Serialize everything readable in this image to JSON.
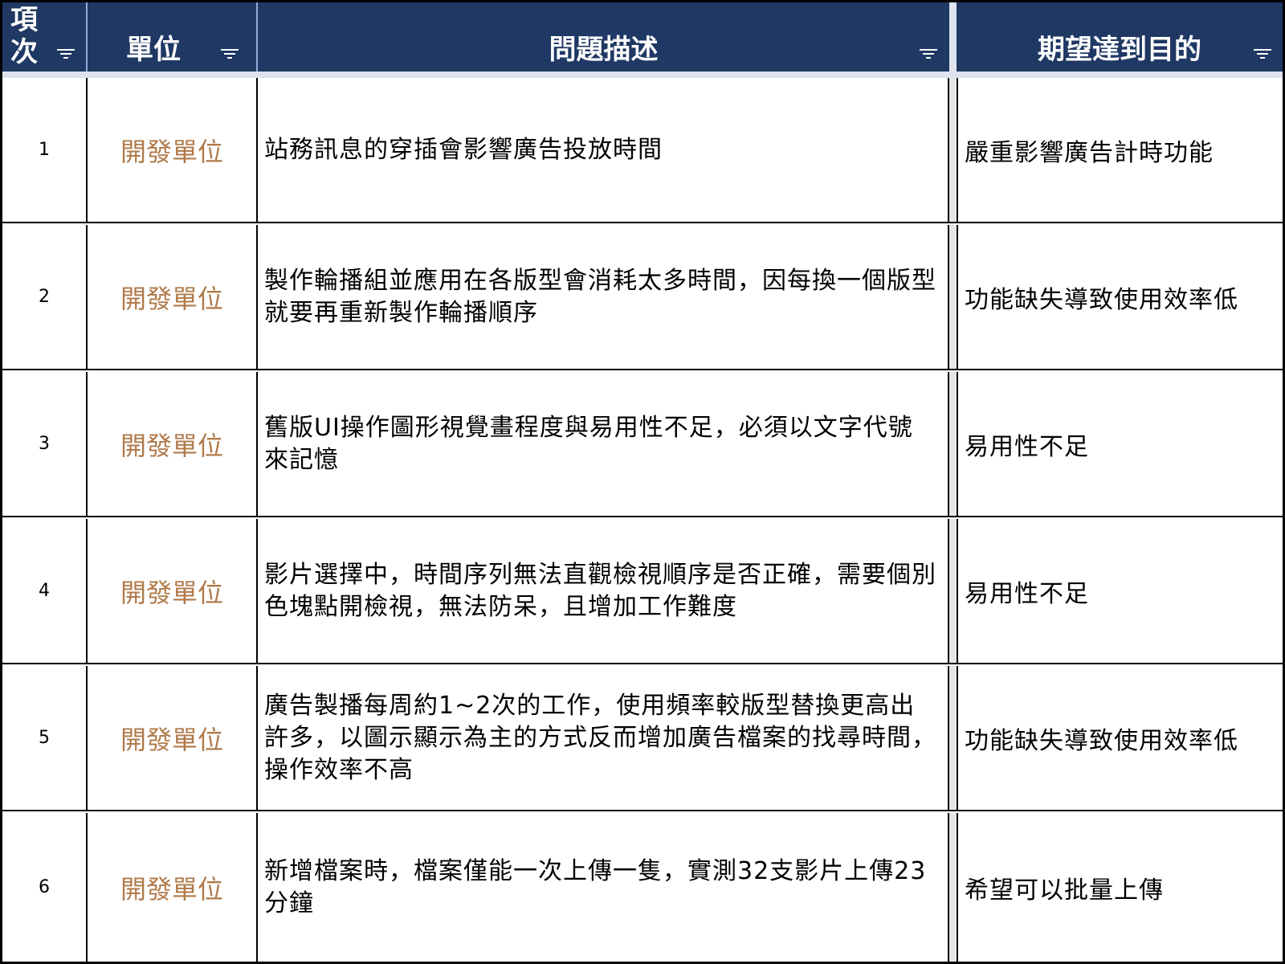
{
  "table": {
    "headers": {
      "index": [
        "項",
        "次"
      ],
      "unit": "單位",
      "problem": "問題描述",
      "goal": "期望達到目的"
    },
    "rows": [
      {
        "index": "1",
        "unit": "開發單位",
        "problem": "站務訊息的穿插會影響廣告投放時間",
        "goal": "嚴重影響廣告計時功能"
      },
      {
        "index": "2",
        "unit": "開發單位",
        "problem": "製作輪播組並應用在各版型會消耗太多時間，因每換一個版型就要再重新製作輪播順序",
        "goal": "功能缺失導致使用效率低"
      },
      {
        "index": "3",
        "unit": "開發單位",
        "problem": "舊版UI操作圖形視覺畫程度與易用性不足，必須以文字代號來記憶",
        "goal": "易用性不足"
      },
      {
        "index": "4",
        "unit": "開發單位",
        "problem": "影片選擇中，時間序列無法直觀檢視順序是否正確，需要個別色塊點開檢視，無法防呆，且增加工作難度",
        "goal": "易用性不足"
      },
      {
        "index": "5",
        "unit": "開發單位",
        "problem": "廣告製播每周約1~2次的工作，使用頻率較版型替換更高出許多，以圖示顯示為主的方式反而增加廣告檔案的找尋時間，操作效率不高",
        "goal": "功能缺失導致使用效率低"
      },
      {
        "index": "6",
        "unit": "開發單位",
        "problem": "新增檔案時，檔案僅能一次上傳一隻，實測32支影片上傳23分鐘",
        "goal": "希望可以批量上傳"
      }
    ]
  },
  "colors": {
    "header_bg": "#1f3864",
    "header_text": "#ffffff",
    "unit_text": "#b07a4a",
    "border": "#000000"
  },
  "icons": {
    "column_filter": "filter-icon"
  }
}
